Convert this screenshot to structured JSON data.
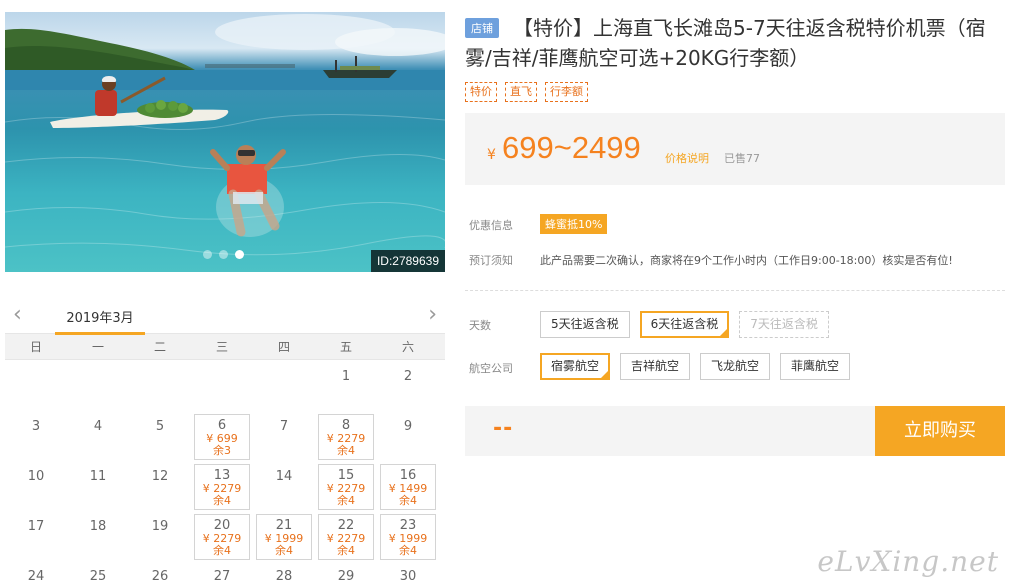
{
  "photo": {
    "id_label": "ID:2789639",
    "dots": [
      {
        "active": false
      },
      {
        "active": false
      },
      {
        "active": true
      }
    ]
  },
  "calendar": {
    "month": "2019年3月",
    "prev_icon": "chevron-left-icon",
    "next_icon": "chevron-right-icon",
    "weekdays": [
      "日",
      "一",
      "二",
      "三",
      "四",
      "五",
      "六"
    ],
    "days": [
      {
        "d": ""
      },
      {
        "d": ""
      },
      {
        "d": ""
      },
      {
        "d": ""
      },
      {
        "d": ""
      },
      {
        "d": "1"
      },
      {
        "d": "2"
      },
      {
        "d": "3"
      },
      {
        "d": "4"
      },
      {
        "d": "5"
      },
      {
        "d": "6",
        "price": "¥ 699",
        "stock": "余3"
      },
      {
        "d": "7"
      },
      {
        "d": "8",
        "price": "¥ 2279",
        "stock": "余4"
      },
      {
        "d": "9"
      },
      {
        "d": "10"
      },
      {
        "d": "11"
      },
      {
        "d": "12"
      },
      {
        "d": "13",
        "price": "¥ 2279",
        "stock": "余4"
      },
      {
        "d": "14"
      },
      {
        "d": "15",
        "price": "¥ 2279",
        "stock": "余4"
      },
      {
        "d": "16",
        "price": "¥ 1499",
        "stock": "余4"
      },
      {
        "d": "17"
      },
      {
        "d": "18"
      },
      {
        "d": "19"
      },
      {
        "d": "20",
        "price": "¥ 2279",
        "stock": "余4"
      },
      {
        "d": "21",
        "price": "¥ 1999",
        "stock": "余4"
      },
      {
        "d": "22",
        "price": "¥ 2279",
        "stock": "余4"
      },
      {
        "d": "23",
        "price": "¥ 1999",
        "stock": "余4"
      },
      {
        "d": "24"
      },
      {
        "d": "25"
      },
      {
        "d": "26"
      },
      {
        "d": "27"
      },
      {
        "d": "28"
      },
      {
        "d": "29"
      },
      {
        "d": "30"
      }
    ]
  },
  "product": {
    "shop_badge": "店铺",
    "title": "【特价】上海直飞长滩岛5-7天往返含税特价机票（宿雾/吉祥/菲鹰航空可选+20KG行李额）",
    "tags": [
      "特价",
      "直飞",
      "行李额"
    ],
    "price_currency": "¥",
    "price": "699~2499",
    "price_note": "价格说明",
    "sold": "已售77",
    "promo_label": "优惠信息",
    "promo_badge": "蜂蜜抵10%",
    "notice_label": "预订须知",
    "notice": "此产品需要二次确认，商家将在9个工作小时内（工作日9:00-18:00）核实是否有位!"
  },
  "options": {
    "days_label": "天数",
    "days": [
      {
        "label": "5天往返含税",
        "state": "normal"
      },
      {
        "label": "6天往返含税",
        "state": "selected"
      },
      {
        "label": "7天往返含税",
        "state": "disabled"
      }
    ],
    "airline_label": "航空公司",
    "airlines": [
      {
        "label": "宿雾航空",
        "state": "selected"
      },
      {
        "label": "吉祥航空",
        "state": "normal"
      },
      {
        "label": "飞龙航空",
        "state": "normal"
      },
      {
        "label": "菲鹰航空",
        "state": "normal"
      }
    ]
  },
  "buy": {
    "total": "--",
    "button": "立即购买"
  },
  "watermark": "eLvXing.net",
  "colors": {
    "accent": "#f5a623",
    "price": "#f5821f",
    "badge_blue": "#6ea0dd"
  }
}
